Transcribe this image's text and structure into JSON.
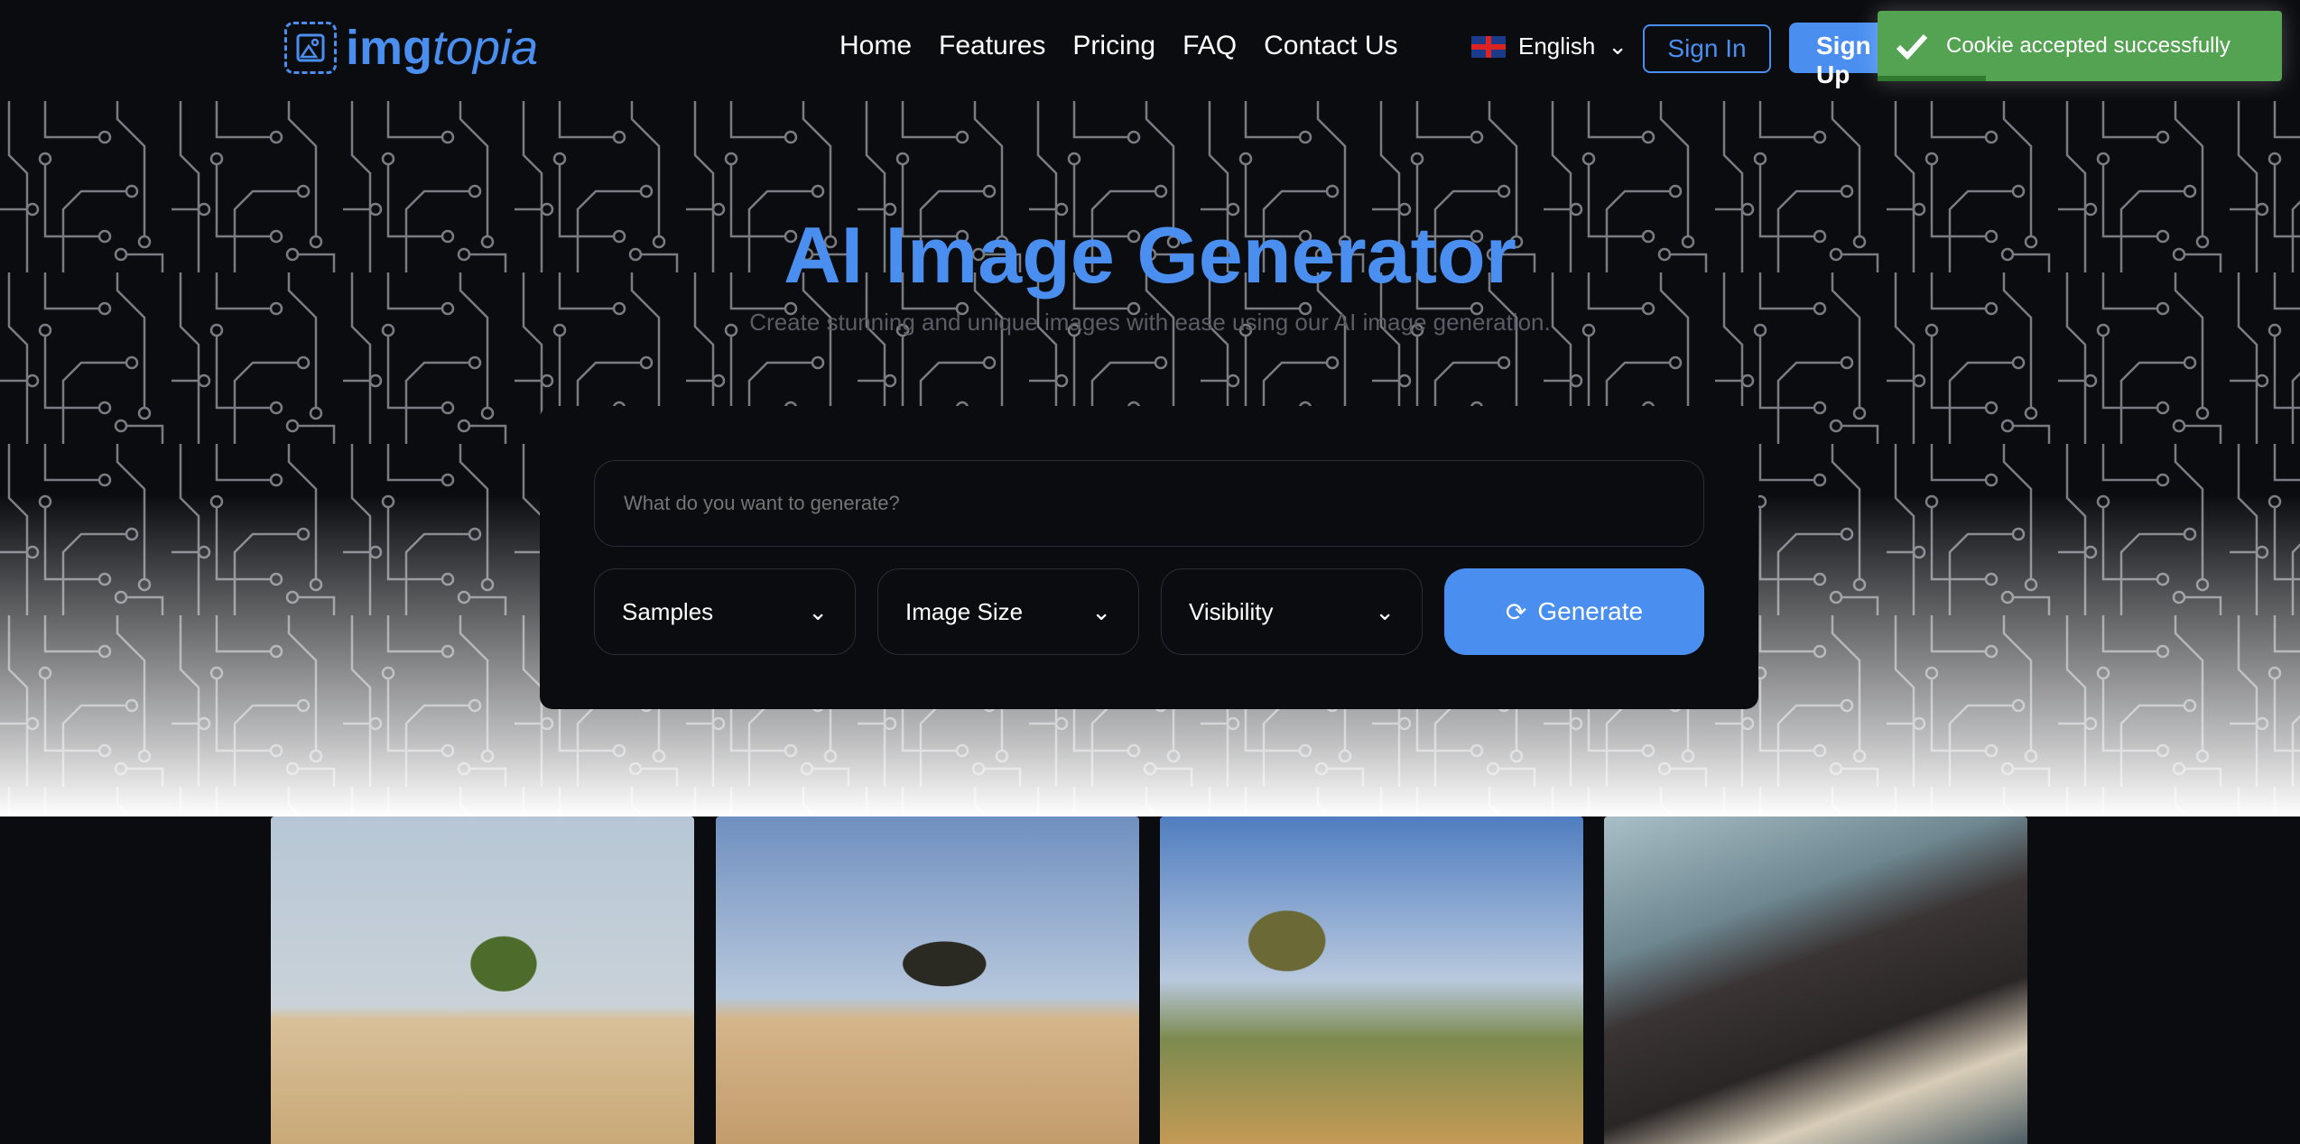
{
  "brand": {
    "bold": "img",
    "italic": "topia"
  },
  "nav": {
    "links": [
      "Home",
      "Features",
      "Pricing",
      "FAQ",
      "Contact Us"
    ],
    "language": "English",
    "sign_in": "Sign In",
    "sign_up": "Sign Up"
  },
  "toast": {
    "message": "Cookie accepted successfully",
    "color": "#53a353"
  },
  "hero": {
    "title": "AI Image Generator",
    "subtitle": "Create stunning and unique images with ease using our AI image generation."
  },
  "form": {
    "prompt_placeholder": "What do you want to generate?",
    "samples": "Samples",
    "image_size": "Image Size",
    "visibility": "Visibility",
    "generate": "Generate"
  },
  "colors": {
    "accent": "#4a8ff0",
    "background": "#0b0c10"
  }
}
